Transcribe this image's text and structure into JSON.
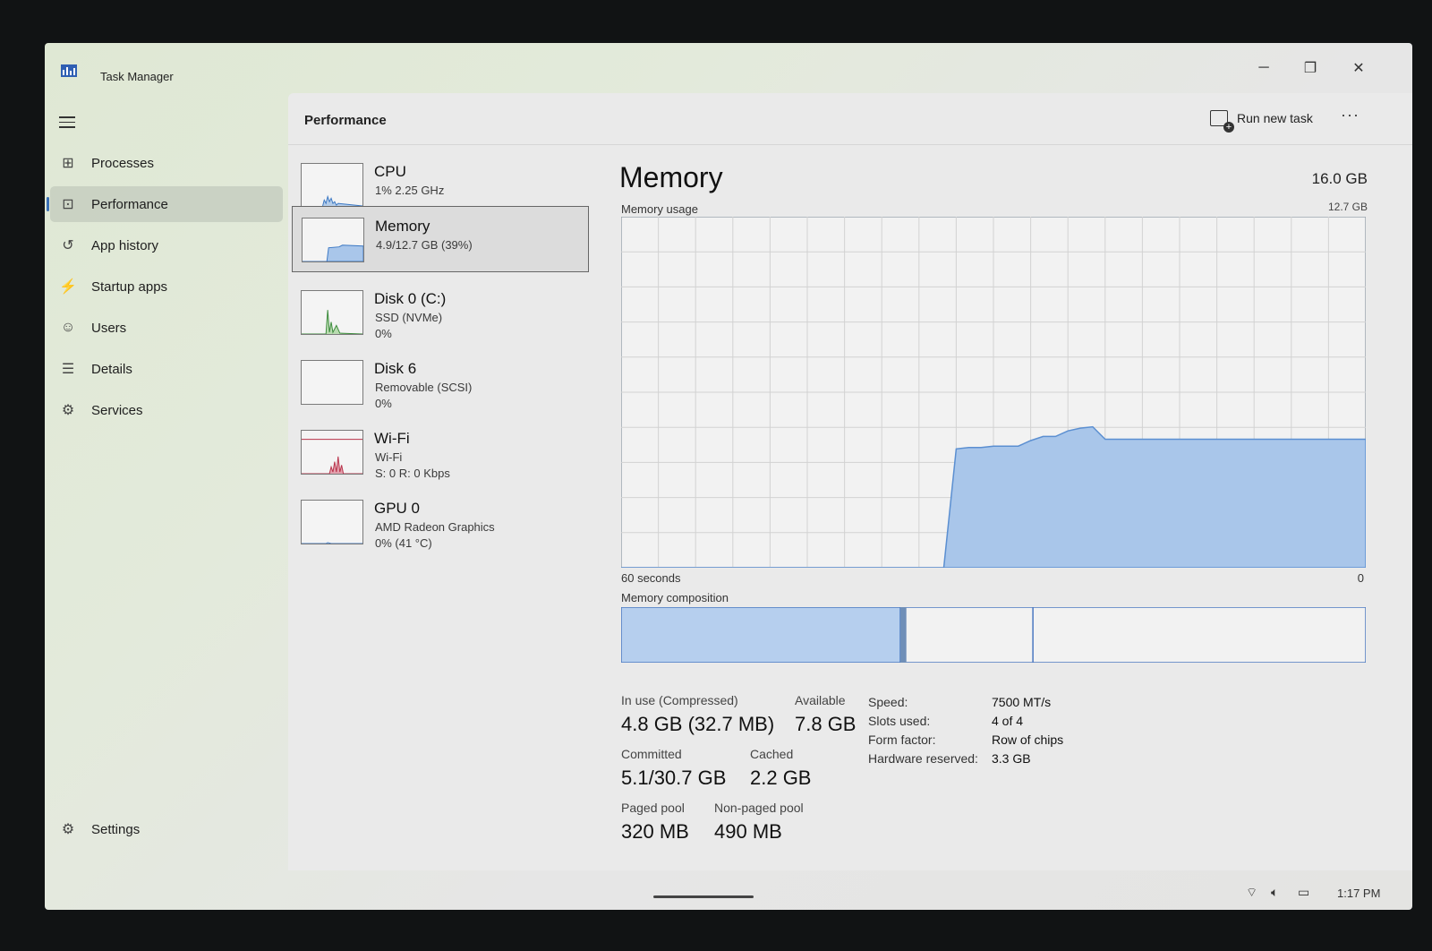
{
  "window": {
    "title": "Task Manager"
  },
  "sidebar": {
    "items": [
      {
        "label": "Processes",
        "icon": "processes-icon"
      },
      {
        "label": "Performance",
        "icon": "performance-icon",
        "active": true
      },
      {
        "label": "App history",
        "icon": "history-icon"
      },
      {
        "label": "Startup apps",
        "icon": "startup-icon"
      },
      {
        "label": "Users",
        "icon": "users-icon"
      },
      {
        "label": "Details",
        "icon": "details-icon"
      },
      {
        "label": "Services",
        "icon": "services-icon"
      }
    ],
    "settings_label": "Settings"
  },
  "header": {
    "title": "Performance",
    "run_task_label": "Run new task",
    "more_label": "···"
  },
  "resources": [
    {
      "name": "CPU",
      "line1": "1% 2.25 GHz",
      "line2": "",
      "color": "#3b78c4"
    },
    {
      "name": "Memory",
      "line1": "4.9/12.7 GB (39%)",
      "line2": "",
      "color": "#3b78c4",
      "active": true
    },
    {
      "name": "Disk 0 (C:)",
      "line1": "SSD (NVMe)",
      "line2": "0%",
      "color": "#3a8a3a"
    },
    {
      "name": "Disk 6",
      "line1": "Removable (SCSI)",
      "line2": "0%",
      "color": "#3a8a3a"
    },
    {
      "name": "Wi-Fi",
      "line1": "Wi-Fi",
      "line2": "S: 0 R: 0 Kbps",
      "color": "#b8324a"
    },
    {
      "name": "GPU 0",
      "line1": "AMD Radeon Graphics",
      "line2": "0% (41 °C)",
      "color": "#3b78c4"
    }
  ],
  "memory": {
    "title": "Memory",
    "total": "16.0 GB",
    "usage_label": "Memory usage",
    "usage_max": "12.7 GB",
    "graph_left": "60 seconds",
    "graph_right": "0",
    "composition_label": "Memory composition",
    "composition_fractions": {
      "in_use": 0.375,
      "modified": 0.008,
      "standby": 0.17
    },
    "stats": {
      "in_use_label": "In use (Compressed)",
      "in_use_value": "4.8 GB (32.7 MB)",
      "available_label": "Available",
      "available_value": "7.8 GB",
      "committed_label": "Committed",
      "committed_value": "5.1/30.7 GB",
      "cached_label": "Cached",
      "cached_value": "2.2 GB",
      "paged_label": "Paged pool",
      "paged_value": "320 MB",
      "nonpaged_label": "Non-paged pool",
      "nonpaged_value": "490 MB"
    },
    "specs": {
      "speed_label": "Speed:",
      "speed_value": "7500 MT/s",
      "slots_label": "Slots used:",
      "slots_value": "4 of 4",
      "form_label": "Form factor:",
      "form_value": "Row of chips",
      "hw_label": "Hardware reserved:",
      "hw_value": "3.3 GB"
    }
  },
  "chart_data": {
    "type": "area",
    "title": "Memory usage",
    "xlabel": "",
    "ylabel": "",
    "x_range_seconds": [
      60,
      0
    ],
    "ylim": [
      0,
      12.7
    ],
    "series": [
      {
        "values": [
          0,
          0,
          0,
          0,
          0,
          0,
          0,
          0,
          0,
          0,
          0,
          0,
          0,
          0,
          0,
          0,
          0,
          0,
          0,
          0,
          0,
          0,
          0,
          0,
          0,
          0,
          0,
          4.3,
          4.35,
          4.35,
          4.4,
          4.4,
          4.4,
          4.6,
          4.75,
          4.75,
          4.95,
          5.05,
          5.1,
          4.65,
          4.65,
          4.65,
          4.65,
          4.65,
          4.65,
          4.65,
          4.65,
          4.65,
          4.65,
          4.65,
          4.65,
          4.65,
          4.65,
          4.65,
          4.65,
          4.65,
          4.65,
          4.65,
          4.65,
          4.65,
          4.65
        ]
      }
    ],
    "colors": {
      "fill": "#a9c6ea",
      "line": "#5b8fd1"
    }
  },
  "taskbar": {
    "time": "1:17 PM"
  }
}
